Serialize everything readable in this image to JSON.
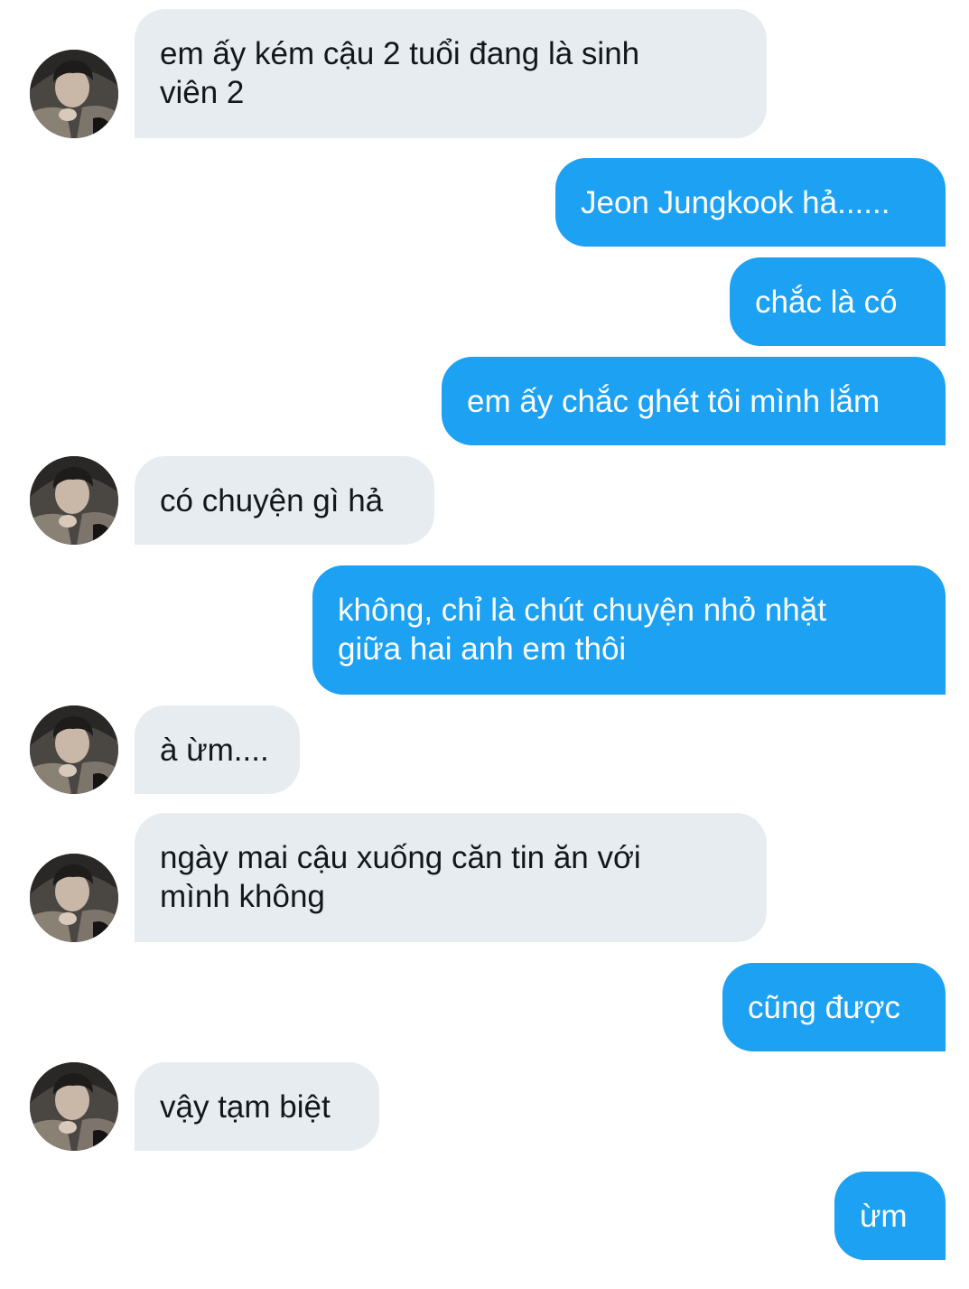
{
  "conversation": {
    "messages": [
      {
        "side": "in",
        "lines": [
          "em ấy kém cậu 2 tuổi đang là sinh",
          "viên 2"
        ]
      },
      {
        "side": "out",
        "lines": [
          "Jeon Jungkook hả......"
        ]
      },
      {
        "side": "out",
        "lines": [
          "chắc là có"
        ]
      },
      {
        "side": "out",
        "lines": [
          "em ấy chắc ghét tôi mình lắm"
        ]
      },
      {
        "side": "in",
        "lines": [
          "có chuyện gì hả"
        ]
      },
      {
        "side": "out",
        "lines": [
          "không, chỉ là chút chuyện nhỏ nhặt",
          "giữa hai anh em thôi"
        ]
      },
      {
        "side": "in",
        "lines": [
          "à ừm...."
        ]
      },
      {
        "side": "in",
        "lines": [
          "ngày mai cậu xuống căn tin ăn với",
          "mình không"
        ]
      },
      {
        "side": "out",
        "lines": [
          "cũng được"
        ]
      },
      {
        "side": "in",
        "lines": [
          "vậy tạm biệt"
        ]
      },
      {
        "side": "out",
        "lines": [
          "ừm"
        ]
      }
    ]
  },
  "colors": {
    "incoming_bubble": "#e6ecf0",
    "incoming_text": "#14171a",
    "outgoing_bubble": "#1da1f2",
    "outgoing_text": "#ffffff"
  },
  "icons": {
    "avatar": "contact-avatar-photo"
  }
}
